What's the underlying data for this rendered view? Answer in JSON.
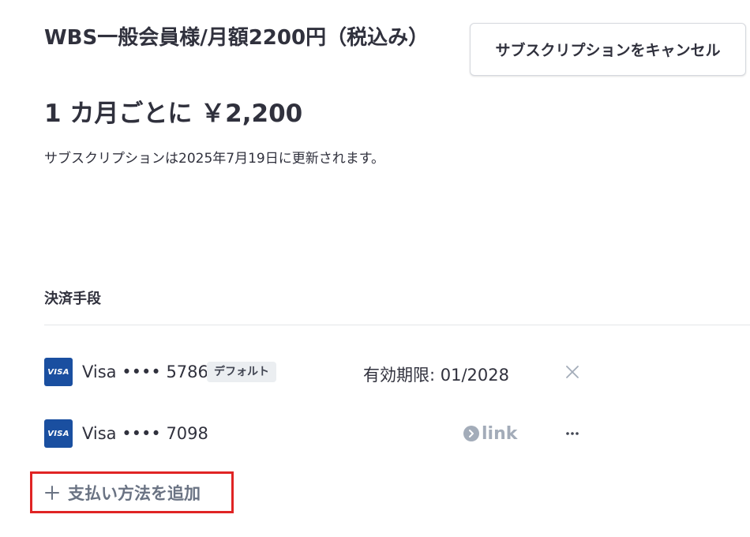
{
  "subscription": {
    "plan_title": "WBS一般会員様/月額2200円（税込み）",
    "price": "1 カ月ごとに ￥2,200",
    "renewal_text": "サブスクリプションは2025年7月19日に更新されます。",
    "cancel_label": "サブスクリプションをキャンセル"
  },
  "payment_methods": {
    "heading": "決済手段",
    "items": [
      {
        "brand_logo": "VISA",
        "label": "Visa •••• 5786",
        "badge": "デフォルト",
        "expiry": "有効期限: 01/2028",
        "action_icon": "close-icon"
      },
      {
        "brand_logo": "VISA",
        "label": "Visa •••• 7098",
        "provider": "link",
        "action_icon": "more-icon"
      }
    ],
    "add_label": "支払い方法を追加",
    "add_icon": "plus-icon"
  },
  "colors": {
    "visa_blue": "#1a4fa0",
    "highlight_border": "#e02424",
    "muted_text": "#6a7383"
  }
}
